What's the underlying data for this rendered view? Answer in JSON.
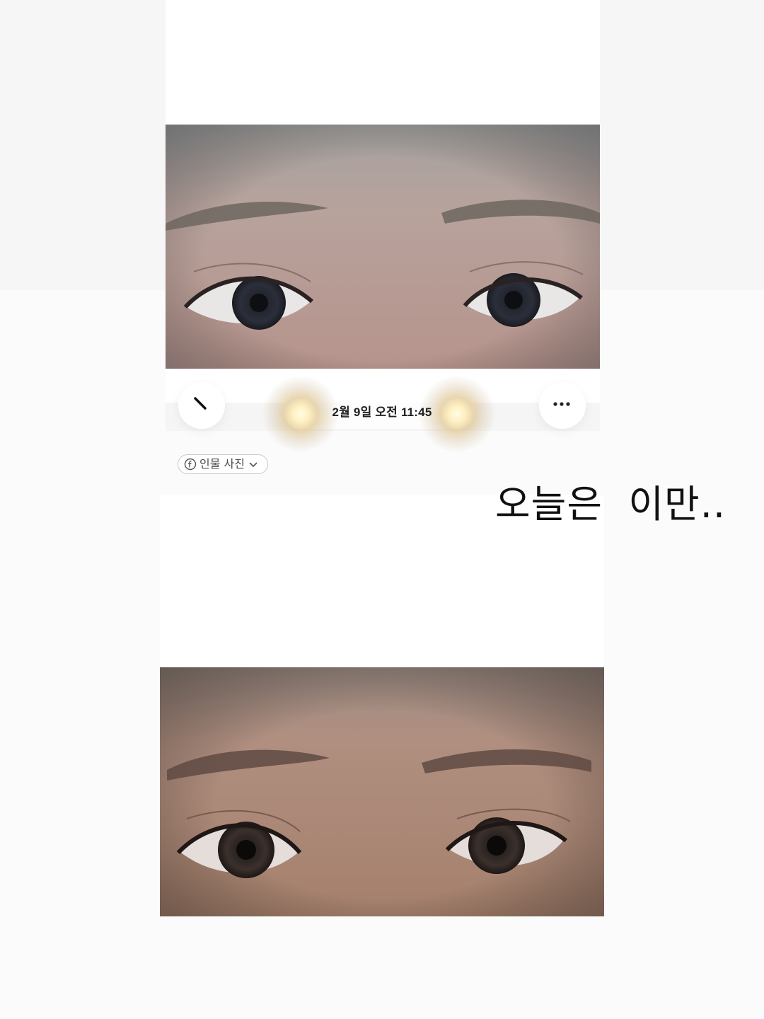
{
  "viewer": {
    "date_label": "2월 9일  오전 11:45",
    "back_icon": "back-arrow-icon",
    "more_icon": "more-dots-icon"
  },
  "people_chip": {
    "icon": "face-icon",
    "label": "인물 사진",
    "chevron_icon": "chevron-down-icon"
  },
  "caption": "오늘은  이만..",
  "colors": {
    "skin_top": "#b79a90",
    "skin_bottom": "#a07a66",
    "glow": "#fff3c8"
  }
}
